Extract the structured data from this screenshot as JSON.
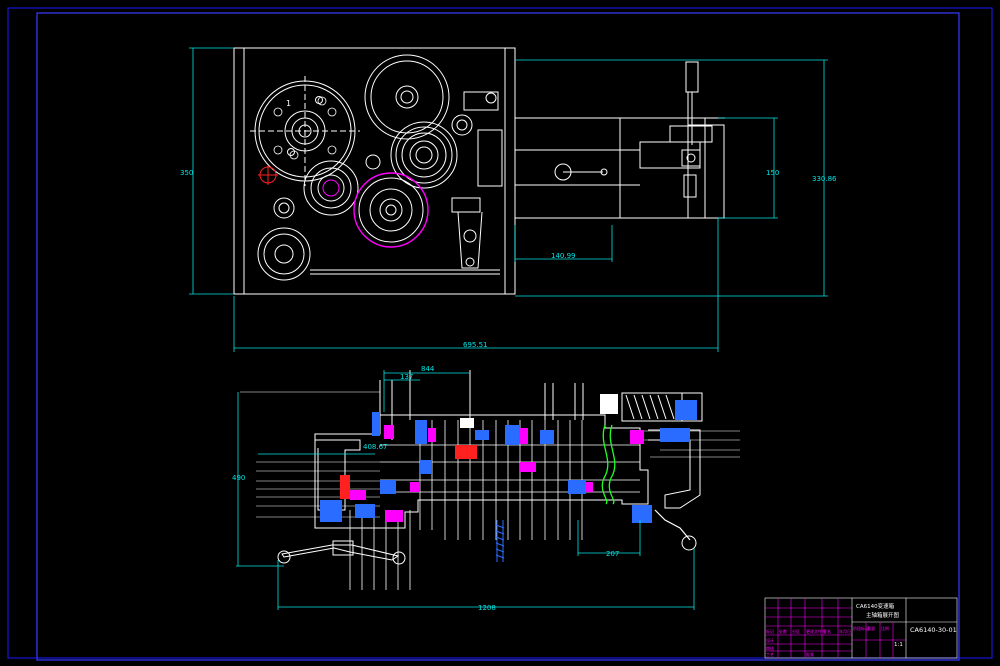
{
  "drawing": {
    "colors": {
      "background": "#000000",
      "frame": "#1a1aff",
      "geometry": "#ffffff",
      "dimension": "#00e5e5",
      "highlight": "#ff00ff",
      "center_mark": "#ff2020",
      "parts_blue": "#2a6cff",
      "table": "#ff00ff"
    },
    "top_view": {
      "dim_height": "350",
      "dim_inner": "150",
      "dim_right": "330.86",
      "dim_slot": "140.99",
      "dim_total": "695.51",
      "gear_number": "1"
    },
    "bottom_view": {
      "dim_844": "844",
      "dim_137": "137",
      "dim_408": "408.67",
      "dim_490": "490",
      "dim_207": "207",
      "dim_1208": "1208"
    },
    "title_block": {
      "title": "CA6140变速箱",
      "subtitle": "主轴箱展开图",
      "drawing_no": "CA6140-30-01",
      "scale": "1:1",
      "cells": [
        "标记",
        "处数",
        "分区",
        "更改文件号",
        "签名",
        "年月日",
        "设计",
        "审核",
        "工艺",
        "批准",
        "阶段标记",
        "重量",
        "比例"
      ]
    }
  }
}
